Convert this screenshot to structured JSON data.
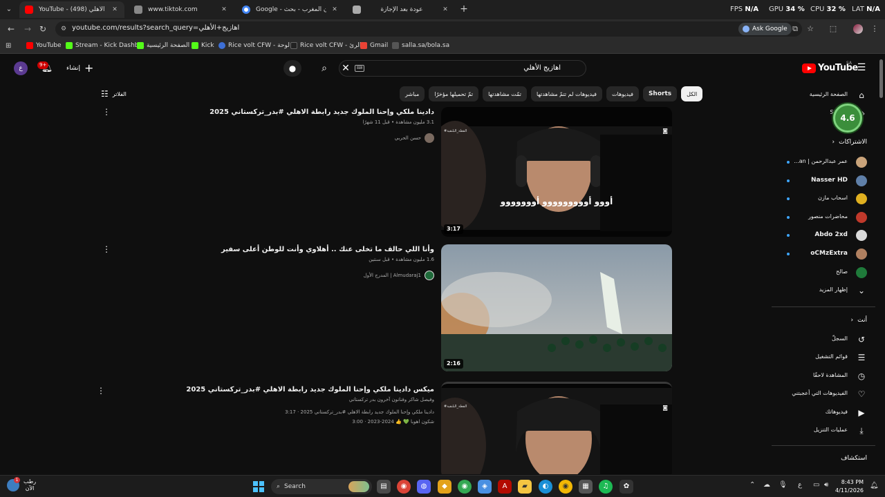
{
  "browser": {
    "tabs": [
      {
        "title": "YouTube - اهازيج الأهلي (498)",
        "icon_color": "#ff0000",
        "active": true
      },
      {
        "title": "www.tiktok.com",
        "icon_color": "#888888",
        "active": false
      },
      {
        "title": "Google - اذان المغرب - بحث",
        "icon_color": "#4285f4",
        "active": false
      },
      {
        "title": "عودة بعد الإجازة",
        "icon_color": "#aaaaaa",
        "active": false
      }
    ],
    "perf": {
      "fps_label": "FPS",
      "fps_value": "N/A",
      "gpu_label": "GPU",
      "gpu_value": "34 %",
      "cpu_label": "CPU",
      "cpu_value": "32 %",
      "lat_label": "LAT",
      "lat_value": "N/A"
    },
    "url": "youtube.com/results?search_query=اهازيج+الأهلي",
    "ask_google": "Ask Google",
    "bookmarks": [
      {
        "label": "YouTube",
        "color": "#ff0000"
      },
      {
        "label": "Stream - Kick Dashb...",
        "color": "#53fc18"
      },
      {
        "label": "الصفحة الرئيسية",
        "color": "#53fc18"
      },
      {
        "label": "Kick",
        "color": "#53fc18"
      },
      {
        "label": "Rice volt CFW - لوحة...",
        "color": "#3d6fd6"
      },
      {
        "label": "Rice volt CFW - الرئ...",
        "color": "#222222"
      },
      {
        "label": "Gmail",
        "color": "#ea4335"
      },
      {
        "label": "salla.sa/bola.sa",
        "color": "#555555"
      }
    ]
  },
  "youtube": {
    "logo": "YouTube",
    "country": "SA",
    "search_value": "اهازيج الأهلي",
    "create_label": "إنشاء",
    "notif_count": "9+",
    "account_initial": "ع",
    "filters_label": "الفلاتر",
    "chips": [
      {
        "label": "الكل",
        "selected": true
      },
      {
        "label": "Shorts",
        "selected": false
      },
      {
        "label": "فيديوهات",
        "selected": false
      },
      {
        "label": "فيديوهات لم تتمّ مشاهدتها",
        "selected": false
      },
      {
        "label": "تمّت مشاهدتها",
        "selected": false
      },
      {
        "label": "تمّ تحميلها مؤخرًا",
        "selected": false
      },
      {
        "label": "مباشر",
        "selected": false
      }
    ],
    "results": [
      {
        "title": "دادينا ملكي وإحنا الملوك جديد رابطة الاهلي #بدر_تركستاني 2025",
        "meta": "3.1 مليون مشاهدة • قبل 11 شهرًا",
        "channel": "حسن الحربي",
        "duration": "3:17",
        "caption": "أووو أووووووووو أووووووو",
        "watermark": "#القطة_البلنقية"
      },
      {
        "title": "وأنا اللي حالف ما تخلى عنك .. أهلاوي وأنت للوطن أعلى سفير",
        "meta": "1.6 مليون مشاهدة • قبل سنتين",
        "channel": "المدرج الأول | Almudaraj1",
        "duration": "2:16"
      },
      {
        "title": "ميكس دادينا ملكي وإحنا الملوك جديد رابطة الاهلي #بدر_تركستاني 2025",
        "meta": "وفيصل شاكر وفنانون آخرون بدر تركستاني",
        "desc1": "دادينا ملكي وإحنا الملوك جديد رابطة الاهلي #بدر_تركستاني 2025 · 3:17",
        "desc2": "شكون اهوبا 💚 👍 2024-2023 · 3:00",
        "watermark": "#القطة_البلنقية"
      }
    ],
    "sidebar": {
      "home": "الصفحة الرئيسية",
      "shorts": "Shorts",
      "subs_header": "الاشتراكات",
      "subs": [
        {
          "name": "عمر عبدالرحمن | an...",
          "color": "#c9a37a"
        },
        {
          "name": "Nasser HD",
          "color": "#5f7fa8"
        },
        {
          "name": "اسحاب مازن",
          "color": "#e0b020"
        },
        {
          "name": "محاضرات منصور",
          "color": "#c0392b"
        },
        {
          "name": "Abdo 2xd",
          "color": "#d9d9d9"
        },
        {
          "name": "oCMzExtra",
          "color": "#b08060"
        },
        {
          "name": "صالح",
          "color": "#1f7a3a"
        }
      ],
      "show_more": "إظهار المزيد",
      "you_header": "أنت",
      "you_items": [
        {
          "label": "السجلّ",
          "icon": "history-icon",
          "glyph": "↺"
        },
        {
          "label": "قوائم التشغيل",
          "icon": "playlists-icon",
          "glyph": "☰"
        },
        {
          "label": "المشاهدة لاحقًا",
          "icon": "watch-later-icon",
          "glyph": "◷"
        },
        {
          "label": "الفيديوهات التي أعجبتني",
          "icon": "like-icon",
          "glyph": "👍"
        },
        {
          "label": "فيديوهاتك",
          "icon": "your-videos-icon",
          "glyph": "▶"
        },
        {
          "label": "عمليات التنزيل",
          "icon": "download-icon",
          "glyph": "⤓"
        }
      ],
      "explore_header": "استكشاف"
    },
    "rating": "4.6"
  },
  "taskbar": {
    "weather_line1": "رطب",
    "weather_line2": "الآن",
    "weather_badge": "1",
    "search_label": "Search",
    "apps": [
      {
        "name": "file-explorer-icon",
        "glyph": "▤",
        "color": "#4a4a4a"
      },
      {
        "name": "chrome-icon",
        "glyph": "◉",
        "color": "#db4437"
      },
      {
        "name": "discord-icon",
        "glyph": "◍",
        "color": "#5865f2"
      },
      {
        "name": "app-icon",
        "glyph": "◆",
        "color": "#e3a21a"
      },
      {
        "name": "chrome-dev-icon",
        "glyph": "◉",
        "color": "#34a853"
      },
      {
        "name": "copilot-icon",
        "glyph": "◈",
        "color": "#4a90e2"
      },
      {
        "name": "acrobat-icon",
        "glyph": "A",
        "color": "#b30b00"
      },
      {
        "name": "folder-icon",
        "glyph": "▰",
        "color": "#f4c542"
      },
      {
        "name": "edge-icon",
        "glyph": "◐",
        "color": "#1a8fd6"
      },
      {
        "name": "app2-icon",
        "glyph": "◉",
        "color": "#f2b705"
      },
      {
        "name": "store-icon",
        "glyph": "▦",
        "color": "#555555"
      },
      {
        "name": "spotify-icon",
        "glyph": "♫",
        "color": "#1db954"
      },
      {
        "name": "app3-icon",
        "glyph": "✿",
        "color": "#333333"
      }
    ],
    "lang": "ع",
    "time": "8:43 PM",
    "date": "4/11/2026"
  }
}
